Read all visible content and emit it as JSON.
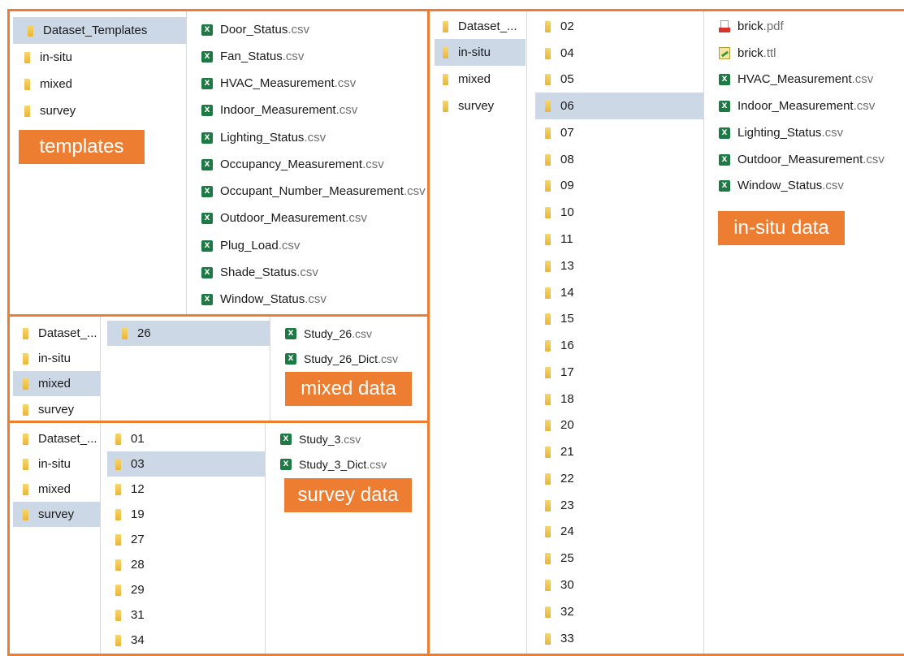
{
  "templates": {
    "nav": [
      "Dataset_Templates",
      "in-situ",
      "mixed",
      "survey"
    ],
    "files": [
      {
        "name": "Door_Status",
        "ext": ".csv"
      },
      {
        "name": "Fan_Status",
        "ext": ".csv"
      },
      {
        "name": "HVAC_Measurement",
        "ext": ".csv"
      },
      {
        "name": "Indoor_Measurement",
        "ext": ".csv"
      },
      {
        "name": "Lighting_Status",
        "ext": ".csv"
      },
      {
        "name": "Occupancy_Measurement",
        "ext": ".csv"
      },
      {
        "name": "Occupant_Number_Measurement",
        "ext": ".csv"
      },
      {
        "name": "Outdoor_Measurement",
        "ext": ".csv"
      },
      {
        "name": "Plug_Load",
        "ext": ".csv"
      },
      {
        "name": "Shade_Status",
        "ext": ".csv"
      },
      {
        "name": "Window_Status",
        "ext": ".csv"
      }
    ],
    "label": "templates"
  },
  "mixed": {
    "nav": [
      "Dataset_...",
      "in-situ",
      "mixed",
      "survey"
    ],
    "folders": [
      "26"
    ],
    "files": [
      {
        "name": "Study_26",
        "ext": ".csv"
      },
      {
        "name": "Study_26_Dict",
        "ext": ".csv"
      }
    ],
    "label": "mixed data"
  },
  "survey": {
    "nav": [
      "Dataset_...",
      "in-situ",
      "mixed",
      "survey"
    ],
    "folders": [
      "01",
      "03",
      "12",
      "19",
      "27",
      "28",
      "29",
      "31",
      "34"
    ],
    "files": [
      {
        "name": "Study_3",
        "ext": ".csv"
      },
      {
        "name": "Study_3_Dict",
        "ext": ".csv"
      }
    ],
    "label": "survey data"
  },
  "insitu": {
    "nav": [
      "Dataset_...",
      "in-situ",
      "mixed",
      "survey"
    ],
    "folders": [
      "02",
      "04",
      "05",
      "06",
      "07",
      "08",
      "09",
      "10",
      "11",
      "13",
      "14",
      "15",
      "16",
      "17",
      "18",
      "20",
      "21",
      "22",
      "23",
      "24",
      "25",
      "30",
      "32",
      "33"
    ],
    "files": [
      {
        "name": "brick",
        "ext": ".pdf",
        "icon": "pdf"
      },
      {
        "name": "brick",
        "ext": ".ttl",
        "icon": "ttl"
      },
      {
        "name": "HVAC_Measurement",
        "ext": ".csv",
        "icon": "xls"
      },
      {
        "name": "Indoor_Measurement",
        "ext": ".csv",
        "icon": "xls"
      },
      {
        "name": "Lighting_Status",
        "ext": ".csv",
        "icon": "xls"
      },
      {
        "name": "Outdoor_Measurement",
        "ext": ".csv",
        "icon": "xls"
      },
      {
        "name": "Window_Status",
        "ext": ".csv",
        "icon": "xls"
      }
    ],
    "label": "in-situ data"
  },
  "colors": {
    "accent": "#ED7D31",
    "selection": "#CCD8E6",
    "excel": "#1D7A45",
    "folder": "#F4C74E"
  }
}
